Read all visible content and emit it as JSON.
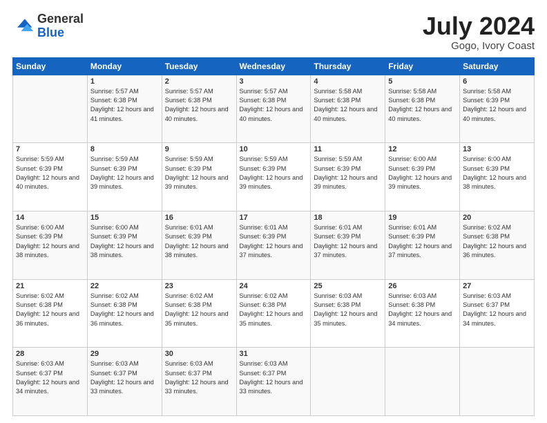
{
  "header": {
    "logo_general": "General",
    "logo_blue": "Blue",
    "month_year": "July 2024",
    "location": "Gogo, Ivory Coast"
  },
  "days_of_week": [
    "Sunday",
    "Monday",
    "Tuesday",
    "Wednesday",
    "Thursday",
    "Friday",
    "Saturday"
  ],
  "weeks": [
    [
      {
        "day": "",
        "sunrise": "",
        "sunset": "",
        "daylight": ""
      },
      {
        "day": "1",
        "sunrise": "Sunrise: 5:57 AM",
        "sunset": "Sunset: 6:38 PM",
        "daylight": "Daylight: 12 hours and 41 minutes."
      },
      {
        "day": "2",
        "sunrise": "Sunrise: 5:57 AM",
        "sunset": "Sunset: 6:38 PM",
        "daylight": "Daylight: 12 hours and 40 minutes."
      },
      {
        "day": "3",
        "sunrise": "Sunrise: 5:57 AM",
        "sunset": "Sunset: 6:38 PM",
        "daylight": "Daylight: 12 hours and 40 minutes."
      },
      {
        "day": "4",
        "sunrise": "Sunrise: 5:58 AM",
        "sunset": "Sunset: 6:38 PM",
        "daylight": "Daylight: 12 hours and 40 minutes."
      },
      {
        "day": "5",
        "sunrise": "Sunrise: 5:58 AM",
        "sunset": "Sunset: 6:38 PM",
        "daylight": "Daylight: 12 hours and 40 minutes."
      },
      {
        "day": "6",
        "sunrise": "Sunrise: 5:58 AM",
        "sunset": "Sunset: 6:39 PM",
        "daylight": "Daylight: 12 hours and 40 minutes."
      }
    ],
    [
      {
        "day": "7",
        "sunrise": "Sunrise: 5:59 AM",
        "sunset": "Sunset: 6:39 PM",
        "daylight": "Daylight: 12 hours and 40 minutes."
      },
      {
        "day": "8",
        "sunrise": "Sunrise: 5:59 AM",
        "sunset": "Sunset: 6:39 PM",
        "daylight": "Daylight: 12 hours and 39 minutes."
      },
      {
        "day": "9",
        "sunrise": "Sunrise: 5:59 AM",
        "sunset": "Sunset: 6:39 PM",
        "daylight": "Daylight: 12 hours and 39 minutes."
      },
      {
        "day": "10",
        "sunrise": "Sunrise: 5:59 AM",
        "sunset": "Sunset: 6:39 PM",
        "daylight": "Daylight: 12 hours and 39 minutes."
      },
      {
        "day": "11",
        "sunrise": "Sunrise: 5:59 AM",
        "sunset": "Sunset: 6:39 PM",
        "daylight": "Daylight: 12 hours and 39 minutes."
      },
      {
        "day": "12",
        "sunrise": "Sunrise: 6:00 AM",
        "sunset": "Sunset: 6:39 PM",
        "daylight": "Daylight: 12 hours and 39 minutes."
      },
      {
        "day": "13",
        "sunrise": "Sunrise: 6:00 AM",
        "sunset": "Sunset: 6:39 PM",
        "daylight": "Daylight: 12 hours and 38 minutes."
      }
    ],
    [
      {
        "day": "14",
        "sunrise": "Sunrise: 6:00 AM",
        "sunset": "Sunset: 6:39 PM",
        "daylight": "Daylight: 12 hours and 38 minutes."
      },
      {
        "day": "15",
        "sunrise": "Sunrise: 6:00 AM",
        "sunset": "Sunset: 6:39 PM",
        "daylight": "Daylight: 12 hours and 38 minutes."
      },
      {
        "day": "16",
        "sunrise": "Sunrise: 6:01 AM",
        "sunset": "Sunset: 6:39 PM",
        "daylight": "Daylight: 12 hours and 38 minutes."
      },
      {
        "day": "17",
        "sunrise": "Sunrise: 6:01 AM",
        "sunset": "Sunset: 6:39 PM",
        "daylight": "Daylight: 12 hours and 37 minutes."
      },
      {
        "day": "18",
        "sunrise": "Sunrise: 6:01 AM",
        "sunset": "Sunset: 6:39 PM",
        "daylight": "Daylight: 12 hours and 37 minutes."
      },
      {
        "day": "19",
        "sunrise": "Sunrise: 6:01 AM",
        "sunset": "Sunset: 6:39 PM",
        "daylight": "Daylight: 12 hours and 37 minutes."
      },
      {
        "day": "20",
        "sunrise": "Sunrise: 6:02 AM",
        "sunset": "Sunset: 6:38 PM",
        "daylight": "Daylight: 12 hours and 36 minutes."
      }
    ],
    [
      {
        "day": "21",
        "sunrise": "Sunrise: 6:02 AM",
        "sunset": "Sunset: 6:38 PM",
        "daylight": "Daylight: 12 hours and 36 minutes."
      },
      {
        "day": "22",
        "sunrise": "Sunrise: 6:02 AM",
        "sunset": "Sunset: 6:38 PM",
        "daylight": "Daylight: 12 hours and 36 minutes."
      },
      {
        "day": "23",
        "sunrise": "Sunrise: 6:02 AM",
        "sunset": "Sunset: 6:38 PM",
        "daylight": "Daylight: 12 hours and 35 minutes."
      },
      {
        "day": "24",
        "sunrise": "Sunrise: 6:02 AM",
        "sunset": "Sunset: 6:38 PM",
        "daylight": "Daylight: 12 hours and 35 minutes."
      },
      {
        "day": "25",
        "sunrise": "Sunrise: 6:03 AM",
        "sunset": "Sunset: 6:38 PM",
        "daylight": "Daylight: 12 hours and 35 minutes."
      },
      {
        "day": "26",
        "sunrise": "Sunrise: 6:03 AM",
        "sunset": "Sunset: 6:38 PM",
        "daylight": "Daylight: 12 hours and 34 minutes."
      },
      {
        "day": "27",
        "sunrise": "Sunrise: 6:03 AM",
        "sunset": "Sunset: 6:37 PM",
        "daylight": "Daylight: 12 hours and 34 minutes."
      }
    ],
    [
      {
        "day": "28",
        "sunrise": "Sunrise: 6:03 AM",
        "sunset": "Sunset: 6:37 PM",
        "daylight": "Daylight: 12 hours and 34 minutes."
      },
      {
        "day": "29",
        "sunrise": "Sunrise: 6:03 AM",
        "sunset": "Sunset: 6:37 PM",
        "daylight": "Daylight: 12 hours and 33 minutes."
      },
      {
        "day": "30",
        "sunrise": "Sunrise: 6:03 AM",
        "sunset": "Sunset: 6:37 PM",
        "daylight": "Daylight: 12 hours and 33 minutes."
      },
      {
        "day": "31",
        "sunrise": "Sunrise: 6:03 AM",
        "sunset": "Sunset: 6:37 PM",
        "daylight": "Daylight: 12 hours and 33 minutes."
      },
      {
        "day": "",
        "sunrise": "",
        "sunset": "",
        "daylight": ""
      },
      {
        "day": "",
        "sunrise": "",
        "sunset": "",
        "daylight": ""
      },
      {
        "day": "",
        "sunrise": "",
        "sunset": "",
        "daylight": ""
      }
    ]
  ]
}
